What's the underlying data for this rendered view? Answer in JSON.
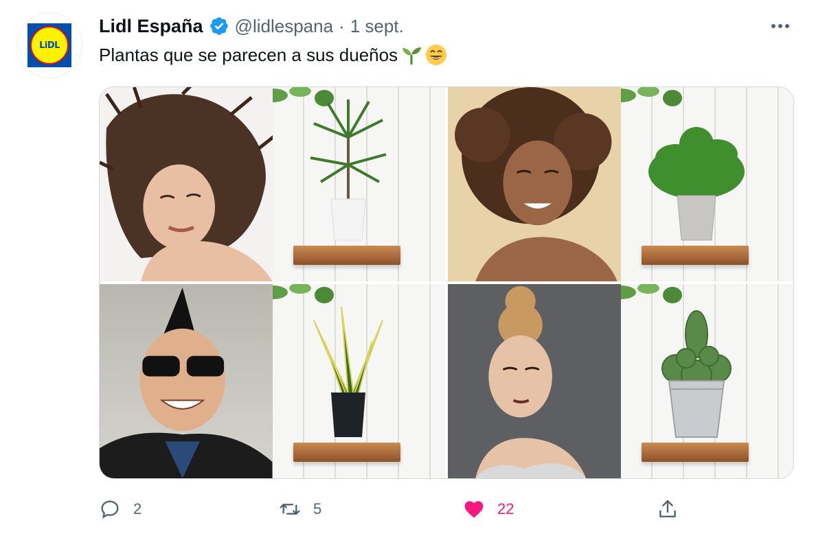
{
  "author": {
    "name": "Lidl España",
    "handle": "@lidlespana",
    "separator": "·",
    "date": "1 sept.",
    "avatar_text": "LiDL"
  },
  "tweet": {
    "text": "Plantas que se parecen a sus dueños",
    "emojis": [
      "seedling-emoji",
      "grinning-emoji"
    ]
  },
  "media": {
    "tiles": [
      {
        "portrait": "woman-windblown-hair",
        "plant": "dracaena-plant"
      },
      {
        "portrait": "woman-curly-hair",
        "plant": "fern-plant"
      },
      {
        "portrait": "man-mohawk-sunglasses",
        "plant": "snake-plant"
      },
      {
        "portrait": "woman-hair-bun",
        "plant": "cactus-plant"
      }
    ]
  },
  "actions": {
    "reply": {
      "icon": "reply-icon",
      "count": "2"
    },
    "retweet": {
      "icon": "retweet-icon",
      "count": "5"
    },
    "like": {
      "icon": "heart-icon",
      "count": "22",
      "active": true
    },
    "share": {
      "icon": "share-icon"
    }
  },
  "colors": {
    "verified": "#1d9bf0",
    "secondary_text": "#536471",
    "like": "#f91880",
    "lidl_blue": "#0050aa",
    "lidl_yellow": "#fff200",
    "lidl_red": "#e60a14"
  }
}
